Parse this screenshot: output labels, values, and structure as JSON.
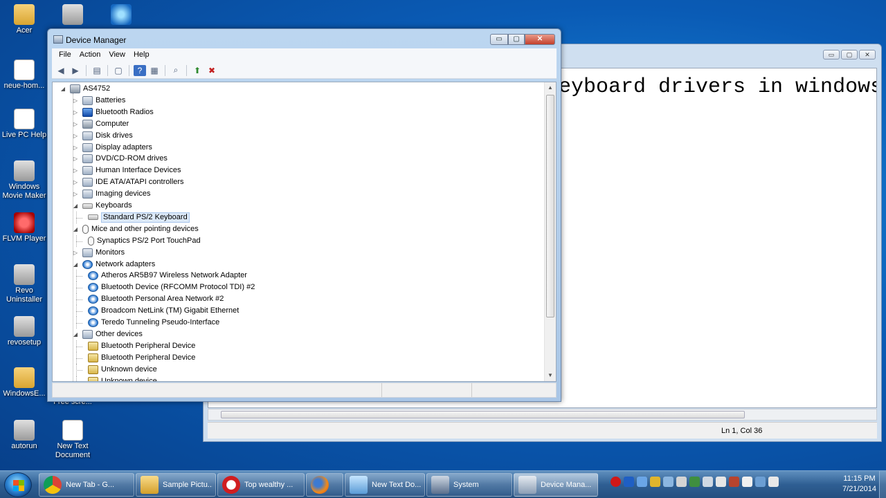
{
  "desktop": {
    "icons": [
      {
        "label": "Acer",
        "icon": "folder-icon"
      },
      {
        "label": "neue-hom...",
        "icon": "file-icon"
      },
      {
        "label": "Live PC Help",
        "icon": "help-icon"
      },
      {
        "label": "Windows Movie Maker",
        "icon": "movie-maker-icon"
      },
      {
        "label": "FLVM Player",
        "icon": "media-player-icon"
      },
      {
        "label": "Revo Uninstaller",
        "icon": "uninstaller-icon"
      },
      {
        "label": "revosetup",
        "icon": "setup-icon"
      },
      {
        "label": "WindowsE...",
        "icon": "folder-icon"
      },
      {
        "label": "autorun",
        "icon": "autorun-icon"
      },
      {
        "label": "New Text Document",
        "icon": "text-file-icon"
      },
      {
        "label": "Free scre...",
        "icon": "app-icon"
      }
    ]
  },
  "notepad": {
    "text": "eyboard drivers in windows",
    "status": "Ln 1, Col 36",
    "controls": [
      "▭",
      "▢",
      "✕"
    ]
  },
  "device_manager": {
    "title": "Device Manager",
    "menu": [
      "File",
      "Action",
      "View",
      "Help"
    ],
    "toolbar": [
      "back-icon",
      "forward-icon",
      "show-hide-icon",
      "properties-icon",
      "help-icon",
      "view-icon",
      "scan-icon",
      "update-driver-icon",
      "uninstall-icon"
    ],
    "controls": {
      "minimize": "▭",
      "maximize": "▢",
      "close": "✕"
    },
    "tree": [
      {
        "label": "AS4752",
        "depth": 0,
        "expander": "◢",
        "icon": "computer-icon"
      },
      {
        "label": "Batteries",
        "depth": 1,
        "expander": "▷",
        "icon": "battery-icon"
      },
      {
        "label": "Bluetooth Radios",
        "depth": 1,
        "expander": "▷",
        "icon": "bluetooth-icon"
      },
      {
        "label": "Computer",
        "depth": 1,
        "expander": "▷",
        "icon": "computer-icon"
      },
      {
        "label": "Disk drives",
        "depth": 1,
        "expander": "▷",
        "icon": "disk-icon"
      },
      {
        "label": "Display adapters",
        "depth": 1,
        "expander": "▷",
        "icon": "display-icon"
      },
      {
        "label": "DVD/CD-ROM drives",
        "depth": 1,
        "expander": "▷",
        "icon": "dvd-icon"
      },
      {
        "label": "Human Interface Devices",
        "depth": 1,
        "expander": "▷",
        "icon": "hid-icon"
      },
      {
        "label": "IDE ATA/ATAPI controllers",
        "depth": 1,
        "expander": "▷",
        "icon": "ide-icon"
      },
      {
        "label": "Imaging devices",
        "depth": 1,
        "expander": "▷",
        "icon": "camera-icon"
      },
      {
        "label": "Keyboards",
        "depth": 1,
        "expander": "◢",
        "icon": "keyboard-icon"
      },
      {
        "label": "Standard PS/2 Keyboard",
        "depth": 2,
        "expander": "",
        "icon": "keyboard-icon",
        "selected": true
      },
      {
        "label": "Mice and other pointing devices",
        "depth": 1,
        "expander": "◢",
        "icon": "mouse-icon"
      },
      {
        "label": "Synaptics PS/2 Port TouchPad",
        "depth": 2,
        "expander": "",
        "icon": "mouse-icon"
      },
      {
        "label": "Monitors",
        "depth": 1,
        "expander": "▷",
        "icon": "monitor-icon"
      },
      {
        "label": "Network adapters",
        "depth": 1,
        "expander": "◢",
        "icon": "network-icon"
      },
      {
        "label": "Atheros AR5B97 Wireless Network Adapter",
        "depth": 2,
        "expander": "",
        "icon": "network-icon"
      },
      {
        "label": "Bluetooth Device (RFCOMM Protocol TDI) #2",
        "depth": 2,
        "expander": "",
        "icon": "network-icon"
      },
      {
        "label": "Bluetooth Personal Area Network #2",
        "depth": 2,
        "expander": "",
        "icon": "network-icon"
      },
      {
        "label": "Broadcom NetLink (TM) Gigabit Ethernet",
        "depth": 2,
        "expander": "",
        "icon": "network-icon"
      },
      {
        "label": "Teredo Tunneling Pseudo-Interface",
        "depth": 2,
        "expander": "",
        "icon": "network-icon"
      },
      {
        "label": "Other devices",
        "depth": 1,
        "expander": "◢",
        "icon": "unknown-device-icon"
      },
      {
        "label": "Bluetooth Peripheral Device",
        "depth": 2,
        "expander": "",
        "icon": "warning-device-icon"
      },
      {
        "label": "Bluetooth Peripheral Device",
        "depth": 2,
        "expander": "",
        "icon": "warning-device-icon"
      },
      {
        "label": "Unknown device",
        "depth": 2,
        "expander": "",
        "icon": "warning-device-icon"
      },
      {
        "label": "Unknown device",
        "depth": 2,
        "expander": "",
        "icon": "warning-device-icon"
      }
    ]
  },
  "taskbar": {
    "tasks": [
      {
        "label": "New Tab - G...",
        "icon": "chrome-icon"
      },
      {
        "label": "Sample Pictu...",
        "icon": "folder-icon"
      },
      {
        "label": "Top wealthy ...",
        "icon": "opera-icon"
      },
      {
        "label": "",
        "icon": "firefox-icon"
      },
      {
        "label": "New Text Do...",
        "icon": "notepad-icon"
      },
      {
        "label": "System",
        "icon": "system-icon"
      },
      {
        "label": "Device Mana...",
        "icon": "device-manager-icon",
        "active": true
      }
    ],
    "time": "11:15 PM",
    "date": "7/21/2014",
    "tray_icons": [
      "record-icon",
      "bluetooth-icon",
      "dropbox-icon",
      "warning-icon",
      "update-icon",
      "speaker-icon",
      "monitor-icon",
      "flag-icon",
      "volume-icon",
      "network-icon",
      "battery-icon",
      "arrow-icon",
      "gear-icon"
    ]
  }
}
